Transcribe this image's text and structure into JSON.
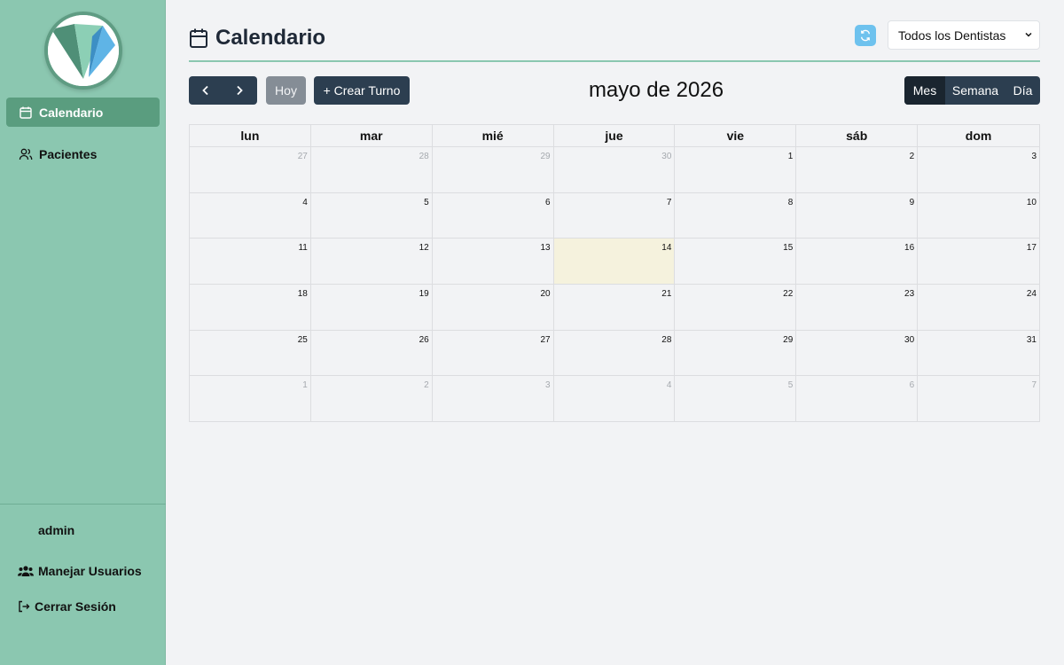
{
  "sidebar": {
    "nav": [
      {
        "label": "Calendario",
        "icon": "calendar-icon",
        "active": true
      },
      {
        "label": "Pacientes",
        "icon": "users-icon",
        "active": false
      }
    ],
    "user": "admin",
    "manage_users": "Manejar Usuarios",
    "logout": "Cerrar Sesión"
  },
  "header": {
    "title": "Calendario",
    "dentist_select": "Todos los Dentistas"
  },
  "toolbar": {
    "today": "Hoy",
    "create": "+ Crear Turno",
    "month_title": "mayo de 2026",
    "views": [
      "Mes",
      "Semana",
      "Día"
    ],
    "active_view": "Mes"
  },
  "calendar": {
    "weekdays": [
      "lun",
      "mar",
      "mié",
      "jue",
      "vie",
      "sáb",
      "dom"
    ],
    "today": "14",
    "weeks": [
      [
        {
          "d": "27",
          "o": true
        },
        {
          "d": "28",
          "o": true
        },
        {
          "d": "29",
          "o": true
        },
        {
          "d": "30",
          "o": true
        },
        {
          "d": "1"
        },
        {
          "d": "2"
        },
        {
          "d": "3"
        }
      ],
      [
        {
          "d": "4"
        },
        {
          "d": "5"
        },
        {
          "d": "6"
        },
        {
          "d": "7"
        },
        {
          "d": "8"
        },
        {
          "d": "9"
        },
        {
          "d": "10"
        }
      ],
      [
        {
          "d": "11"
        },
        {
          "d": "12"
        },
        {
          "d": "13"
        },
        {
          "d": "14",
          "t": true
        },
        {
          "d": "15"
        },
        {
          "d": "16"
        },
        {
          "d": "17"
        }
      ],
      [
        {
          "d": "18"
        },
        {
          "d": "19"
        },
        {
          "d": "20"
        },
        {
          "d": "21"
        },
        {
          "d": "22"
        },
        {
          "d": "23"
        },
        {
          "d": "24"
        }
      ],
      [
        {
          "d": "25"
        },
        {
          "d": "26"
        },
        {
          "d": "27"
        },
        {
          "d": "28"
        },
        {
          "d": "29"
        },
        {
          "d": "30"
        },
        {
          "d": "31"
        }
      ],
      [
        {
          "d": "1",
          "o": true
        },
        {
          "d": "2",
          "o": true
        },
        {
          "d": "3",
          "o": true
        },
        {
          "d": "4",
          "o": true
        },
        {
          "d": "5",
          "o": true
        },
        {
          "d": "6",
          "o": true
        },
        {
          "d": "7",
          "o": true
        }
      ]
    ]
  },
  "colors": {
    "sidebar": "#8bc7b0",
    "active_nav": "#5a9d7f",
    "primary_button": "#2c3e50",
    "today_cell": "#f5f2dd",
    "refresh_button": "#6ec2ee"
  }
}
